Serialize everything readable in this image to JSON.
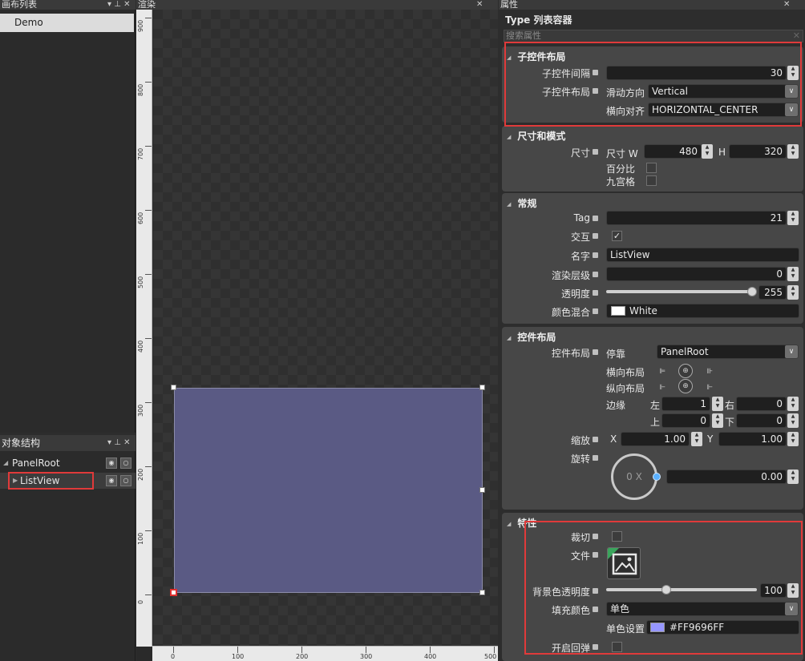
{
  "panels": {
    "canvas_list_title": "画布列表",
    "render_title": "渲染",
    "props_title": "属性",
    "object_tree_title": "对象结构"
  },
  "canvas_list": {
    "items": [
      "Demo"
    ]
  },
  "object_tree": {
    "items": [
      {
        "label": "PanelRoot"
      },
      {
        "label": "ListView"
      }
    ]
  },
  "render": {
    "v_ticks": [
      "900",
      "800",
      "700",
      "600",
      "500",
      "400",
      "300",
      "200",
      "100",
      "0"
    ],
    "h_ticks": [
      "0",
      "100",
      "200",
      "300",
      "400",
      "500"
    ]
  },
  "props": {
    "type_line": "Type  列表容器",
    "search_placeholder": "搜索属性",
    "child_layout": {
      "title": "子控件布局",
      "spacing_label": "子控件间隔",
      "spacing_value": "30",
      "layout_label": "子控件布局",
      "scroll_dir_label": "滑动方向",
      "scroll_dir_value": "Vertical",
      "h_align_label": "横向对齐",
      "h_align_value": "HORIZONTAL_CENTER"
    },
    "size_mode": {
      "title": "尺寸和模式",
      "size_label": "尺寸",
      "size_w_label": "尺寸 W",
      "w_value": "480",
      "h_label": "H",
      "h_value": "320",
      "percent_label": "百分比",
      "nine_grid_label": "九宫格"
    },
    "general": {
      "title": "常规",
      "tag_label": "Tag",
      "tag_value": "21",
      "interact_label": "交互",
      "interact_check": "✓",
      "name_label": "名字",
      "name_value": "ListView",
      "zorder_label": "渲染层级",
      "zorder_value": "0",
      "opacity_label": "透明度",
      "opacity_value": "255",
      "blend_label": "颜色混合",
      "blend_value": "White"
    },
    "widget_layout": {
      "title": "控件布局",
      "layout_label": "控件布局",
      "dock_label": "停靠",
      "dock_value": "PanelRoot",
      "h_layout_label": "横向布局",
      "v_layout_label": "纵向布局",
      "margin_label": "边缘",
      "left_label": "左",
      "left_value": "1",
      "right_label": "右",
      "right_value": "0",
      "top_label": "上",
      "top_value": "0",
      "bottom_label": "下",
      "bottom_value": "0",
      "scale_label": "缩放",
      "scale_x_label": "X",
      "scale_x_value": "1.00",
      "scale_y_label": "Y",
      "scale_y_value": "1.00",
      "rotate_label": "旋转",
      "rotate_dial": "0 X",
      "rotate_value": "0.00"
    },
    "features": {
      "title": "特性",
      "clip_label": "裁切",
      "file_label": "文件",
      "bg_opacity_label": "背景色透明度",
      "bg_opacity_value": "100",
      "fill_color_label": "填充颜色",
      "fill_color_value": "单色",
      "single_color_label": "单色设置",
      "single_color_value": "#FF9696FF",
      "bounce_label": "开启回弹"
    }
  },
  "colors": {
    "listview_fill": "#5a5a84",
    "swatch_color": "#9696ff",
    "highlight_red": "#e03a3a"
  }
}
